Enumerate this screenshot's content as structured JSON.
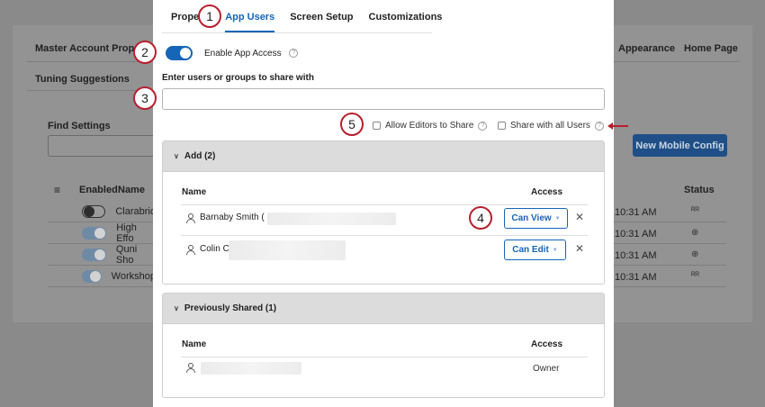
{
  "background": {
    "tabs_left": [
      "Master Account Properti",
      "Tuning Suggestions"
    ],
    "tabs_right": [
      "Appearance",
      "Home Page"
    ],
    "find_settings_label": "Find Settings",
    "new_button": "New Mobile Config",
    "table_headers": {
      "enabled": "Enabled",
      "name": "Name",
      "status": "Status"
    },
    "rows": [
      {
        "name": "Clarabrid",
        "time": "10:31 AM",
        "enabled": false
      },
      {
        "name": "High Effo",
        "time": "10:31 AM",
        "enabled": true
      },
      {
        "name": "Quni Sho",
        "time": "10:31 AM",
        "enabled": true
      },
      {
        "name": "Workshop",
        "time": "10:31 AM",
        "enabled": true
      }
    ]
  },
  "modal": {
    "tabs": [
      "Prope",
      "App Users",
      "Screen Setup",
      "Customizations"
    ],
    "active_tab": "App Users",
    "enable_label": "Enable App Access",
    "enable_on": true,
    "share_label": "Enter users or groups to share with",
    "share_placeholder": "",
    "allow_editors": "Allow Editors to Share",
    "share_all": "Share with all Users",
    "add_section": {
      "title": "Add (2)",
      "col_name": "Name",
      "col_access": "Access",
      "rows": [
        {
          "name": "Barnaby Smith (",
          "access": "Can View"
        },
        {
          "name": "Colin C",
          "access": "Can Edit"
        }
      ]
    },
    "prev_section": {
      "title": "Previously Shared (1)",
      "col_name": "Name",
      "col_access": "Access",
      "rows": [
        {
          "name": "",
          "access": "Owner"
        }
      ]
    }
  },
  "callouts": [
    "1",
    "2",
    "3",
    "4",
    "5"
  ],
  "colors": {
    "accent": "#1565b8",
    "callout": "#b7202e"
  }
}
